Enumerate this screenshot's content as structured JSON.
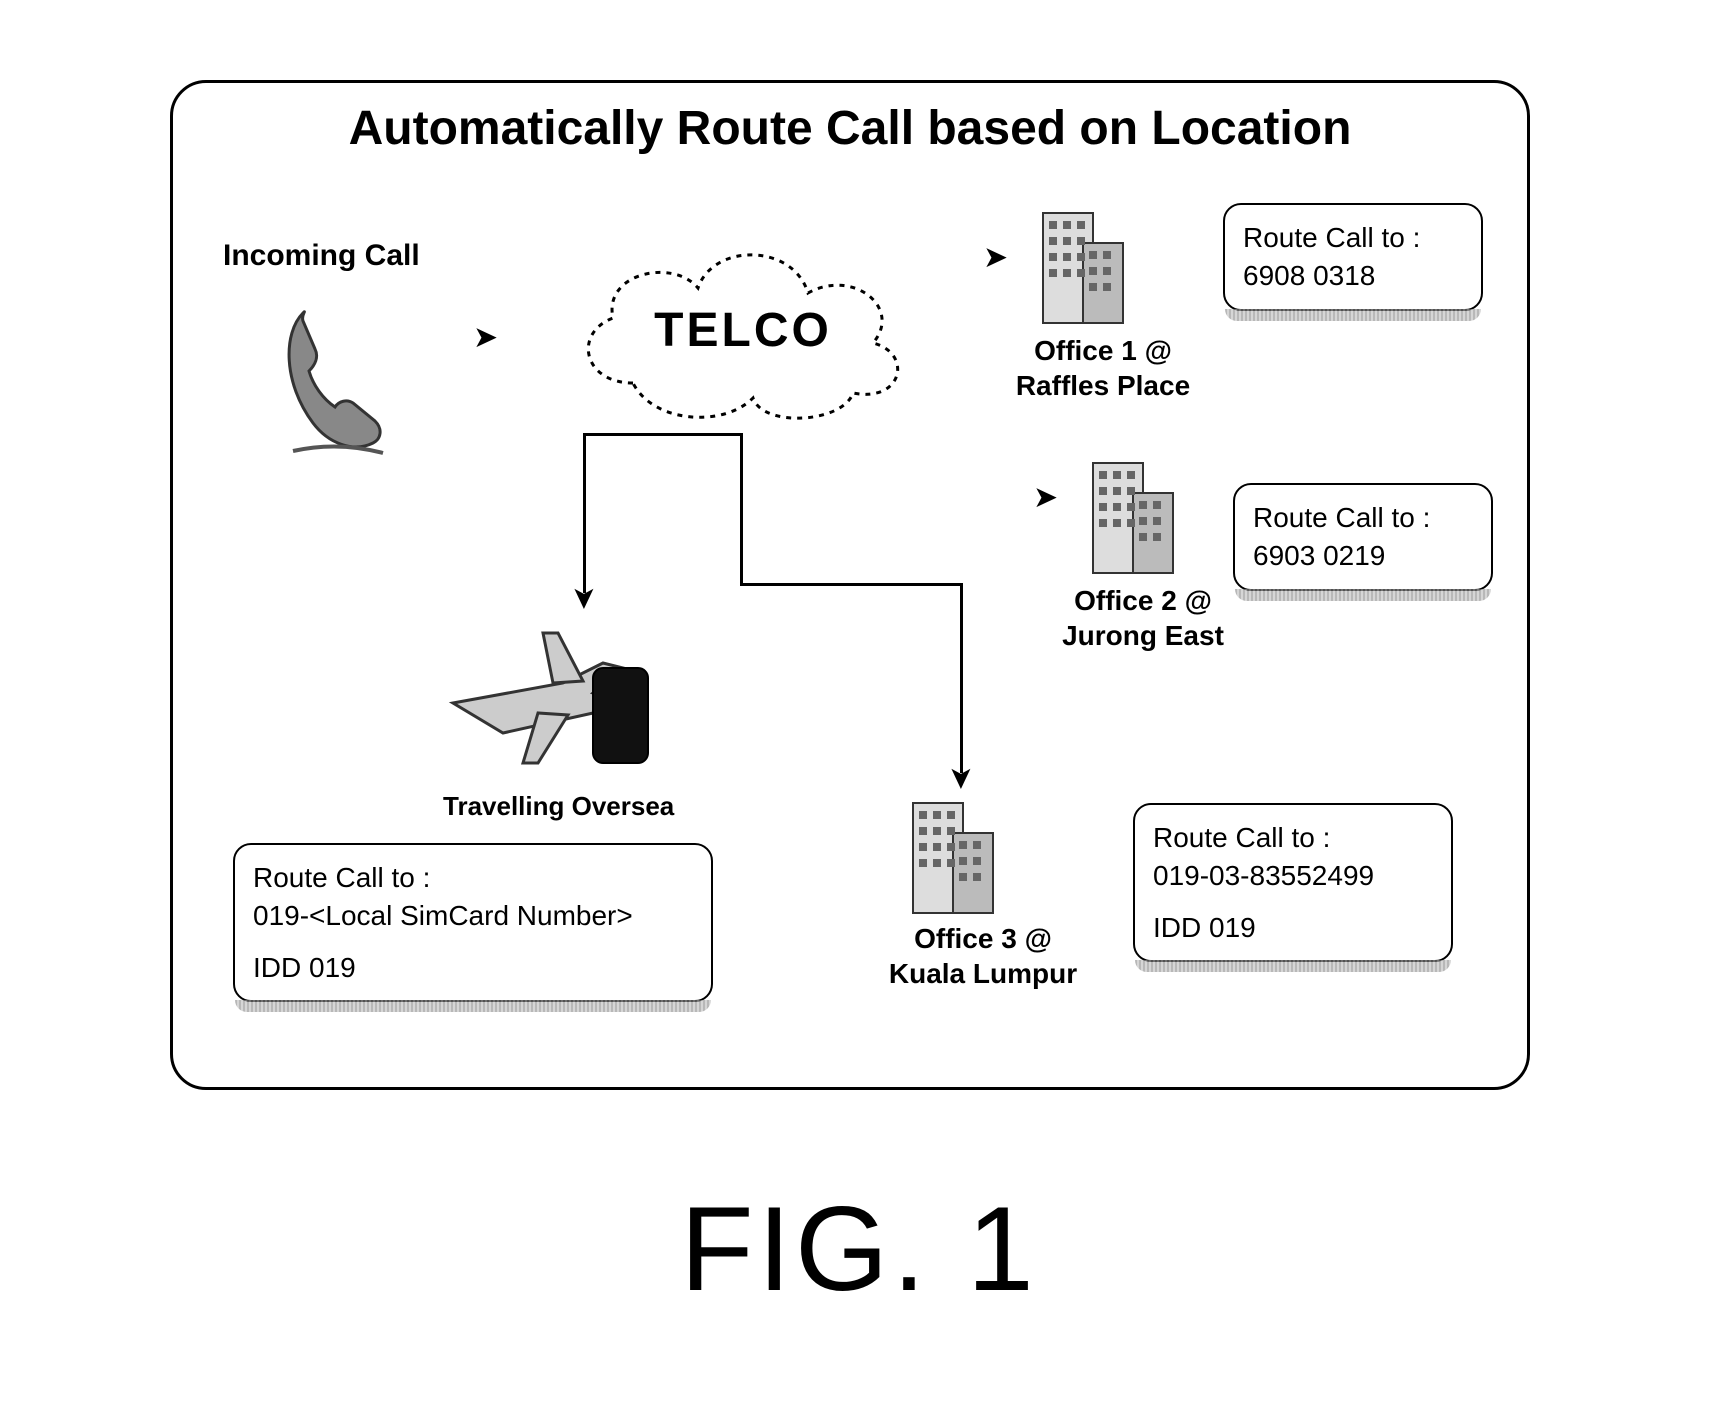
{
  "figure_caption": "FIG. 1",
  "panel": {
    "title": "Automatically Route Call based on Location",
    "incoming_label": "Incoming Call",
    "cloud_label": "TELCO",
    "travelling_label": "Travelling Oversea",
    "offices": {
      "office1": {
        "label_line1": "Office 1 @",
        "label_line2": "Raffles Place"
      },
      "office2": {
        "label_line1": "Office 2 @",
        "label_line2": "Jurong East"
      },
      "office3": {
        "label_line1": "Office 3 @",
        "label_line2": "Kuala Lumpur"
      }
    },
    "routes": {
      "office1": {
        "line1": "Route Call to :",
        "line2": "6908 0318"
      },
      "office2": {
        "line1": "Route Call to :",
        "line2": "6903 0219"
      },
      "office3": {
        "line1": "Route Call to :",
        "line2": "019-03-83552499",
        "idd": "IDD 019"
      },
      "travel": {
        "line1": "Route Call to :",
        "line2": "019-<Local SimCard Number>",
        "idd": "IDD 019"
      }
    }
  }
}
